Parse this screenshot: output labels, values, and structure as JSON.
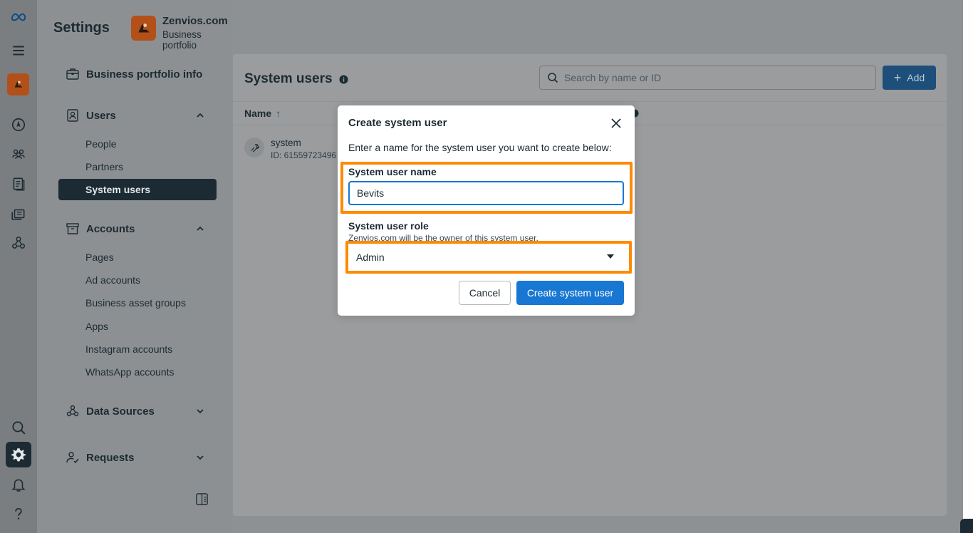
{
  "sidebar": {
    "title": "Settings",
    "business": {
      "name": "Zenvios.com",
      "subtitle": "Business portfolio"
    },
    "portfolio_info": "Business portfolio info",
    "users": {
      "label": "Users",
      "items": [
        "People",
        "Partners",
        "System users"
      ],
      "selected": "System users"
    },
    "accounts": {
      "label": "Accounts",
      "items": [
        "Pages",
        "Ad accounts",
        "Business asset groups",
        "Apps",
        "Instagram accounts",
        "WhatsApp accounts"
      ]
    },
    "data_sources": "Data Sources",
    "requests": "Requests"
  },
  "main": {
    "title": "System users",
    "search_placeholder": "Search by name or ID",
    "add_label": "Add",
    "column_name": "Name",
    "column_sort": "↑",
    "rows": [
      {
        "name": "system",
        "id": "ID: 61559723496"
      }
    ]
  },
  "modal": {
    "title": "Create system user",
    "description": "Enter a name for the system user you want to create below:",
    "name_label": "System user name",
    "name_value": "Bevits",
    "role_label": "System user role",
    "role_help": "Zenvios.com will be the owner of this system user.",
    "role_value": "Admin",
    "cancel_label": "Cancel",
    "create_label": "Create system user"
  },
  "colors": {
    "accent": "#1877d2",
    "highlight": "#ff8a00",
    "dark": "#1c2b33"
  },
  "icons": [
    "meta-logo-icon",
    "menu-icon",
    "home-icon",
    "users-icon",
    "pages-icon",
    "ads-icon",
    "integrations-icon",
    "search-icon",
    "gear-icon",
    "bell-icon",
    "help-icon"
  ]
}
